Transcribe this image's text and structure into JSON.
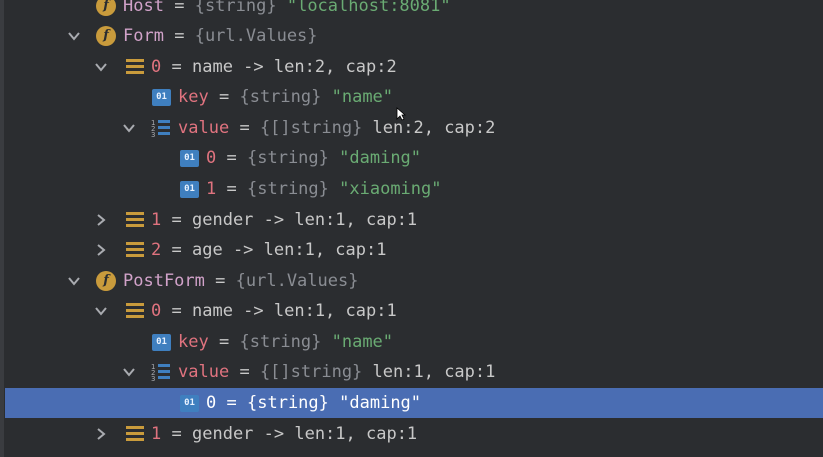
{
  "rows": [
    {
      "name": "Host",
      "type": "{string}",
      "value": "\"localhost:8081\""
    },
    {
      "name": "Form",
      "type": "{url.Values}"
    },
    {
      "name": "0",
      "rest": "name -> len:2, cap:2"
    },
    {
      "name": "key",
      "type": "{string}",
      "value": "\"name\""
    },
    {
      "name": "value",
      "type": "{[]string}",
      "rest": "len:2, cap:2"
    },
    {
      "name": "0",
      "type": "{string}",
      "value": "\"daming\""
    },
    {
      "name": "1",
      "type": "{string}",
      "value": "\"xiaoming\""
    },
    {
      "name": "1",
      "rest": "gender -> len:1, cap:1"
    },
    {
      "name": "2",
      "rest": "age -> len:1, cap:1"
    },
    {
      "name": "PostForm",
      "type": "{url.Values}"
    },
    {
      "name": "0",
      "rest": "name -> len:1, cap:1"
    },
    {
      "name": "key",
      "type": "{string}",
      "value": "\"name\""
    },
    {
      "name": "value",
      "type": "{[]string}",
      "rest": "len:1, cap:1"
    },
    {
      "name": "0",
      "type": "{string}",
      "value": "\"daming\""
    },
    {
      "name": "1",
      "rest": "gender -> len:1, cap:1"
    }
  ],
  "eq": "=",
  "icons": {
    "field": "f",
    "primitive": "01",
    "map_entry": "list-icon",
    "slice": "slice-icon"
  },
  "colors": {
    "background": "#2b2d30",
    "selection": "#4a6db3",
    "field_name": "#d1a2c9",
    "key_name": "#e0737f",
    "string_value": "#6aab73",
    "type": "#8a8d93"
  }
}
